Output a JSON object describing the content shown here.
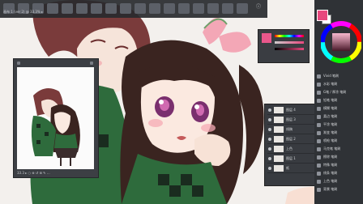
{
  "titlebar": {
    "document_label": "画布 1 (ver 2) @ 33.3% ▸",
    "tool_label": "ⓘ"
  },
  "navigator": {
    "footer": "33.3 ▸ ○ ⊕ ↺ ⊞ ✎ …"
  },
  "color": {
    "foreground": "#e8487e",
    "background": "#ffffff"
  },
  "layers_panel": {
    "rows": [
      {
        "name": "图层 4"
      },
      {
        "name": "图层 3"
      },
      {
        "name": "线稿"
      },
      {
        "name": "图层 2"
      },
      {
        "name": "上色"
      },
      {
        "name": "图层 1"
      },
      {
        "name": "纸"
      }
    ]
  },
  "right_panel": {
    "rows": [
      {
        "label": "Vivid 笔刷"
      },
      {
        "label": "水彩 笔刷"
      },
      {
        "label": "G笔 / 厚涂 笔刷"
      },
      {
        "label": "铅笔 笔刷"
      },
      {
        "label": "模糊 笔刷"
      },
      {
        "label": "柔边 笔刷"
      },
      {
        "label": "平涂 笔刷"
      },
      {
        "label": "渐变 笔刷"
      },
      {
        "label": "喷枪 笔刷"
      },
      {
        "label": "马克笔 笔刷"
      },
      {
        "label": "擦除 笔刷"
      },
      {
        "label": "特殊 笔刷"
      },
      {
        "label": "线条 笔刷"
      },
      {
        "label": "上色 笔刷"
      },
      {
        "label": "背景 笔刷"
      }
    ]
  }
}
